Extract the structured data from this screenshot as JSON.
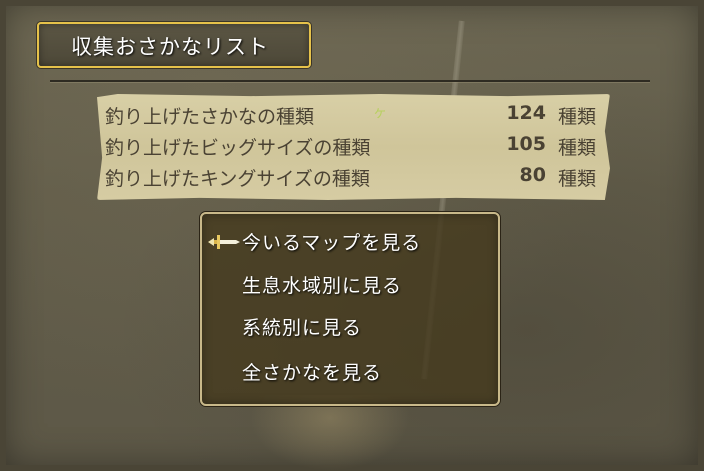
{
  "window": {
    "title": "収集おさかなリスト"
  },
  "stats": [
    {
      "label": "釣り上げたさかなの種類",
      "value": "124",
      "unit": "種類"
    },
    {
      "label": "釣り上げたビッグサイズの種類",
      "value": "105",
      "unit": "種類"
    },
    {
      "label": "釣り上げたキングサイズの種類",
      "value": "80",
      "unit": "種類"
    }
  ],
  "menu": {
    "items": [
      {
        "label": "今いるマップを見る",
        "selected": true
      },
      {
        "label": "生息水域別に見る",
        "selected": false
      },
      {
        "label": "系統別に見る",
        "selected": false
      },
      {
        "label": "全さかなを見る",
        "selected": false
      }
    ],
    "cursor_icon": "sword-cursor-icon"
  },
  "colors": {
    "title_border": "#e6c24a",
    "menu_border": "#c9b98a",
    "stats_panel": "#d8cfa6",
    "stats_text": "#4a4233"
  }
}
